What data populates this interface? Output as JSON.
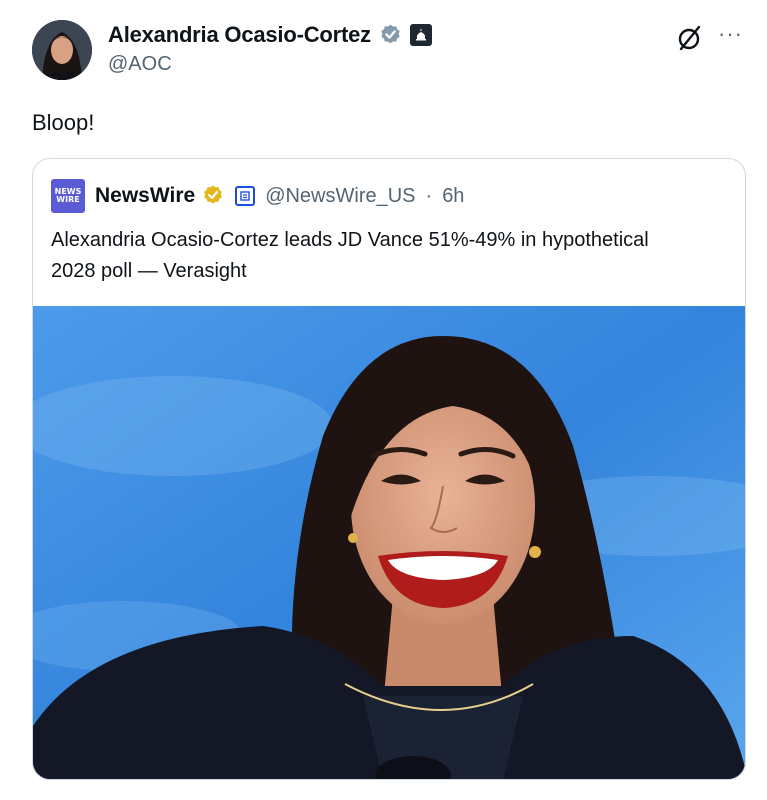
{
  "author": {
    "display_name": "Alexandria Ocasio-Cortez",
    "handle": "@AOC",
    "avatar_icon": "profile-photo",
    "verified_color": "#829aab",
    "government_badge_icon": "capitol-icon"
  },
  "tweet": {
    "text": "Bloop!"
  },
  "actions": {
    "grok_icon": "grok-icon",
    "more_icon": "more-icon",
    "more_label": "···"
  },
  "quote": {
    "logo_line1": "NEWS",
    "logo_line2": "WIRE",
    "display_name": "NewsWire",
    "verified_color": "#e2b719",
    "handle": "@NewsWire_US",
    "separator": "·",
    "time": "6h",
    "text": "Alexandria Ocasio-Cortez leads JD Vance 51%-49% in hypothetical 2028 poll — Verasight",
    "image": {
      "background_color": "#3f8fe0",
      "icon": "smiling-woman-photo"
    }
  }
}
